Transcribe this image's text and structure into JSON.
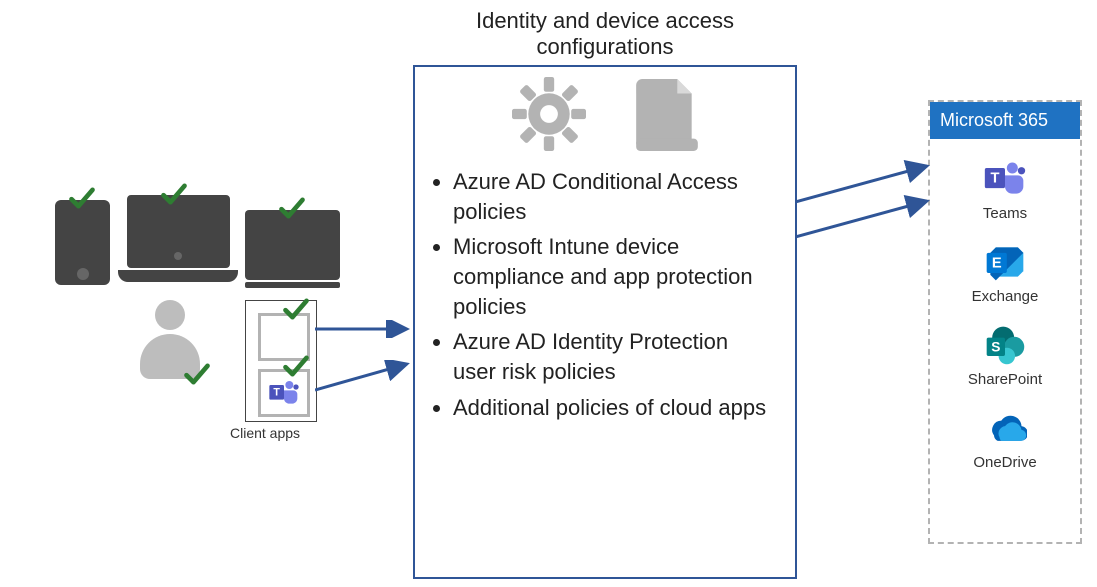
{
  "center": {
    "title": "Identity and device access configurations",
    "policies": [
      "Azure AD Conditional Access policies",
      "Microsoft Intune device compliance and app protection policies",
      "Azure AD Identity Protection user risk policies",
      "Additional policies of cloud apps"
    ]
  },
  "client_apps_label": "Client apps",
  "m365": {
    "header": "Microsoft 365",
    "services": [
      {
        "name": "Teams"
      },
      {
        "name": "Exchange"
      },
      {
        "name": "SharePoint"
      },
      {
        "name": "OneDrive"
      }
    ]
  }
}
